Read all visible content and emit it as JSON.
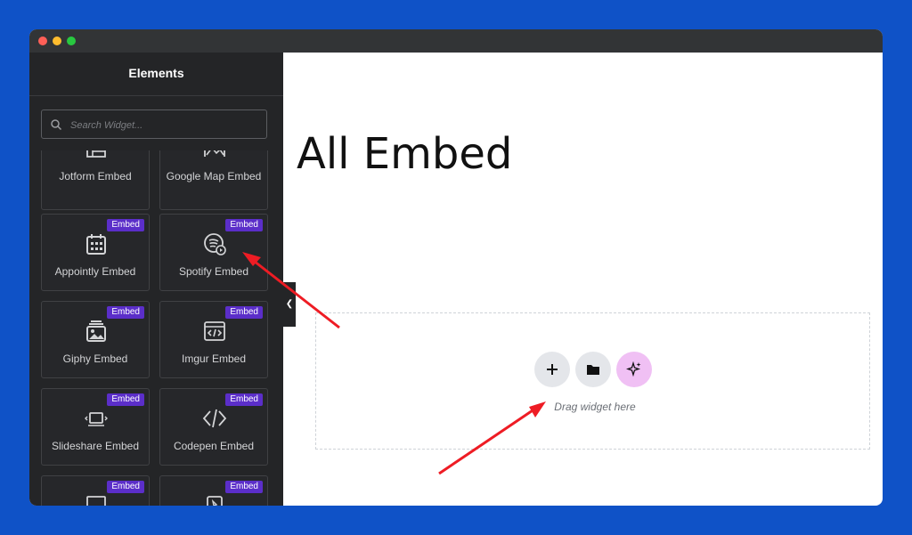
{
  "sidebar": {
    "title": "Elements",
    "search_placeholder": "Search Widget...",
    "cards": [
      {
        "label": "Jotform Embed",
        "icon": "form-icon",
        "badge": ""
      },
      {
        "label": "Google Map Embed",
        "icon": "map-icon",
        "badge": ""
      },
      {
        "label": "Appointly Embed",
        "icon": "calendar-icon",
        "badge": "Embed"
      },
      {
        "label": "Spotify Embed",
        "icon": "spotify-icon",
        "badge": "Embed"
      },
      {
        "label": "Giphy Embed",
        "icon": "image-stack-icon",
        "badge": "Embed"
      },
      {
        "label": "Imgur Embed",
        "icon": "code-window-icon",
        "badge": "Embed"
      },
      {
        "label": "Slideshare Embed",
        "icon": "slides-icon",
        "badge": "Embed"
      },
      {
        "label": "Codepen Embed",
        "icon": "code-icon",
        "badge": "Embed"
      },
      {
        "label": "",
        "icon": "monitor-icon",
        "badge": "Embed"
      },
      {
        "label": "",
        "icon": "pin-icon",
        "badge": "Embed"
      }
    ]
  },
  "canvas": {
    "heading": "All Embed",
    "drag_text": "Drag widget here"
  },
  "colors": {
    "background": "#0f52c7",
    "sidebar": "#242527",
    "badge": "#5b2ec9",
    "arrow": "#ee1c24",
    "ai_button": "#f0c0f4"
  }
}
